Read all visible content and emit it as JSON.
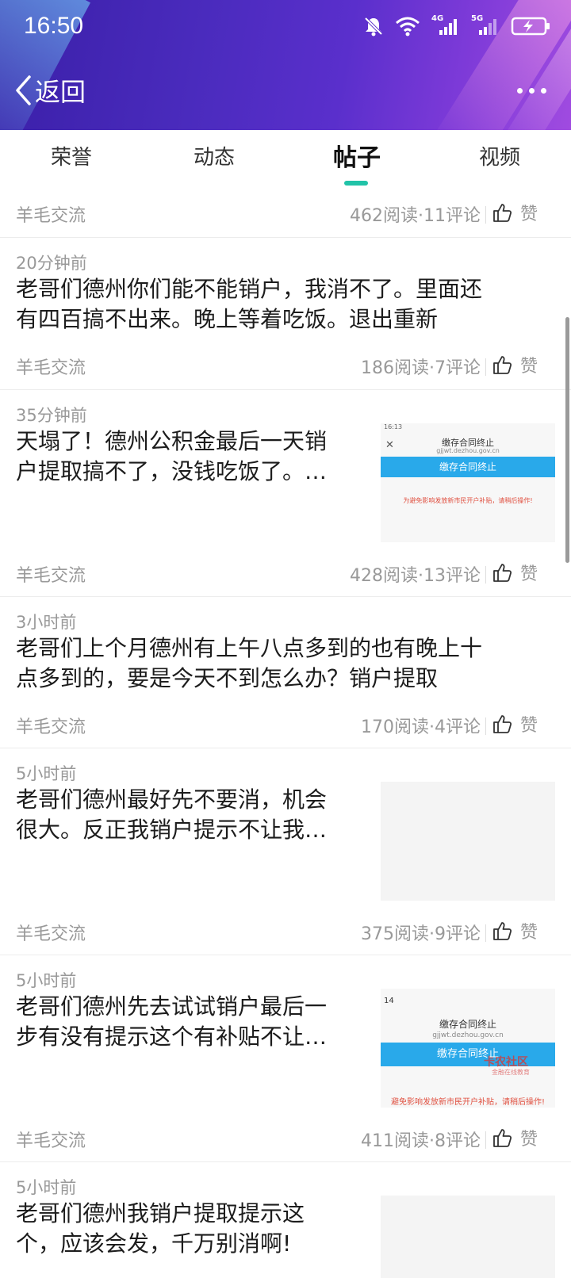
{
  "status": {
    "time": "16:50",
    "net4g": "4G",
    "net5g": "5G"
  },
  "nav": {
    "back_label": "返回"
  },
  "tabs": [
    "荣誉",
    "动态",
    "帖子",
    "视频"
  ],
  "active_tab": 2,
  "posts": [
    {
      "tag": "羊毛交流",
      "stats": "462阅读·11评论",
      "like": "赞"
    },
    {
      "time": "20分钟前",
      "title_l1": "老哥们德州你们能不能销户，我消不了。里面还",
      "title_l2": "有四百搞不出来。晚上等着吃饭。退出重新",
      "tag": "羊毛交流",
      "stats": "186阅读·7评论",
      "like": "赞"
    },
    {
      "time": "35分钟前",
      "title_l1": "天塌了！德州公积金最后一天销",
      "title_l2": "户提取搞不了，没钱吃饭了。…",
      "tag": "羊毛交流",
      "stats": "428阅读·13评论",
      "like": "赞",
      "thumb": {
        "header": "缴存合同终止",
        "url": "gjjwt.dezhou.gov.cn",
        "bar": "缴存合同终止",
        "warning": "为避免影响发放新市民开户补贴，请稍后操作!",
        "time": "16:13"
      }
    },
    {
      "time": "3小时前",
      "title_l1": "老哥们上个月德州有上午八点多到的也有晚上十",
      "title_l2": "点多到的，要是今天不到怎么办？销户提取",
      "tag": "羊毛交流",
      "stats": "170阅读·4评论",
      "like": "赞"
    },
    {
      "time": "5小时前",
      "title_l1": "老哥们德州最好先不要消，机会",
      "title_l2": "很大。反正我销户提示不让我…",
      "tag": "羊毛交流",
      "stats": "375阅读·9评论",
      "like": "赞"
    },
    {
      "time": "5小时前",
      "title_l1": "老哥们德州先去试试销户最后一",
      "title_l2": "步有没有提示这个有补贴不让…",
      "tag": "羊毛交流",
      "stats": "411阅读·8评论",
      "like": "赞",
      "thumb": {
        "header": "缴存合同终止",
        "url": "gjjwt.dezhou.gov.cn",
        "bar": "缴存合同终止",
        "warning": "避免影响发放新市民开户补贴，请稍后操作!",
        "time": "14",
        "watermark": "卡农社区",
        "watermark_sub": "金融在线教育"
      }
    },
    {
      "time": "5小时前",
      "title_l1": "老哥们德州我销户提取提示这",
      "title_l2": "个，应该会发，千万别消啊!"
    }
  ]
}
